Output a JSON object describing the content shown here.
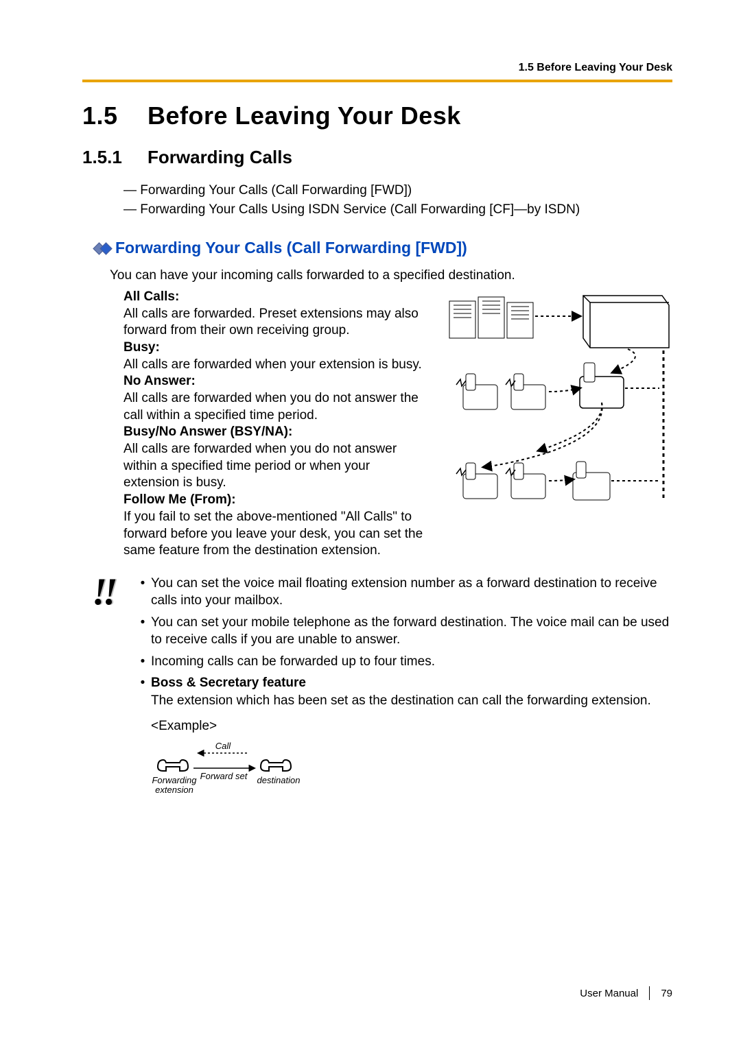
{
  "running_header": "1.5 Before Leaving Your Desk",
  "section": {
    "number": "1.5",
    "title": "Before Leaving Your Desk"
  },
  "subsection": {
    "number": "1.5.1",
    "title": "Forwarding Calls"
  },
  "dash_items": [
    "Forwarding Your Calls (Call Forwarding [FWD])",
    "Forwarding Your Calls Using ISDN Service (Call Forwarding [CF]—by ISDN)"
  ],
  "fwd_heading": "Forwarding Your Calls (Call Forwarding [FWD])",
  "intro": "You can have your incoming calls forwarded to a specified destination.",
  "modes": [
    {
      "title": "All Calls:",
      "text": "All calls are forwarded. Preset extensions may also forward from their own receiving group."
    },
    {
      "title": "Busy:",
      "text": "All calls are forwarded when your extension is busy."
    },
    {
      "title": "No Answer:",
      "text": "All calls are forwarded when you do not answer the call within a specified time period."
    },
    {
      "title": "Busy/No Answer (BSY/NA):",
      "text": "All calls are forwarded when you do not answer within a specified time period or when your extension is busy."
    },
    {
      "title": "Follow Me (From):",
      "text": "If you fail to set the above-mentioned \"All Calls\" to forward before you leave your desk, you can set the same feature from the destination extension."
    }
  ],
  "notes": [
    {
      "bold": "",
      "text": "You can set the voice mail floating extension number as a forward destination to receive calls into your mailbox."
    },
    {
      "bold": "",
      "text": "You can set your mobile telephone as the forward destination. The voice mail can be used to receive calls if you are unable to answer."
    },
    {
      "bold": "",
      "text": "Incoming calls can be forwarded up to four times."
    },
    {
      "bold": "Boss & Secretary feature",
      "text": "The extension which has been set as the destination can call the forwarding extension."
    }
  ],
  "example_label": "<Example>",
  "example_fig": {
    "call_label": "Call",
    "forward_set_label": "Forward set",
    "forwarding_ext_label": "Forwarding extension",
    "destination_label": "destination"
  },
  "footer": {
    "doc": "User Manual",
    "page": "79"
  }
}
